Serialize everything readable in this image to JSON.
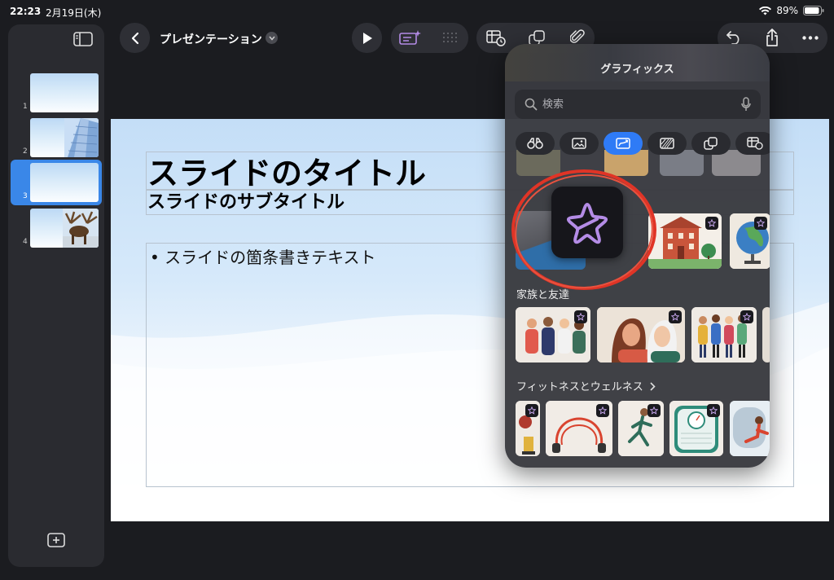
{
  "status": {
    "time": "22:23",
    "date": "2月19日(木)",
    "battery": "89%"
  },
  "sidebar": {
    "slides": [
      {
        "number": "1"
      },
      {
        "number": "2"
      },
      {
        "number": "3",
        "selected": true
      },
      {
        "number": "4"
      }
    ]
  },
  "toolbar": {
    "doc_title": "プレゼンテーション"
  },
  "slide": {
    "title": "スライドのタイトル",
    "subtitle": "スライドのサブタイトル",
    "bullet": "スライドの箇条書きテキスト"
  },
  "graphics": {
    "title": "グラフィックス",
    "search_placeholder": "検索",
    "sections": [
      {
        "label": "家族と友達"
      },
      {
        "label": "フィットネスとウェルネス"
      }
    ]
  },
  "colors": {
    "accent": "#2f7bf6",
    "highlight_ring": "#e03426",
    "star": "#b48ce6"
  }
}
